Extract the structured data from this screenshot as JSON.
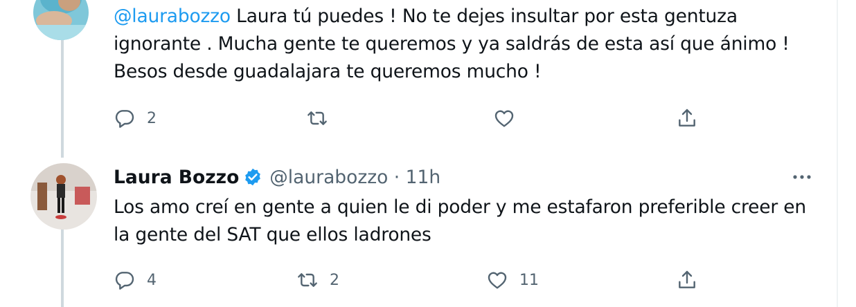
{
  "reply_tweet": {
    "mention": "@laurabozzo",
    "text_line1_rest": " Laura tú puedes ! No te dejes insultar por esta gentuza",
    "text_line2": "ignorante . Mucha gente te queremos y ya saldrás de esta así que ánimo !",
    "text_line3": "Besos desde guadalajara te queremos mucho !",
    "actions": {
      "reply_count": "2",
      "retweet_count": "",
      "like_count": ""
    }
  },
  "main_tweet": {
    "display_name": "Laura Bozzo",
    "handle_time": "@laurabozzo · 11h",
    "text_line1": "Los amo creí en gente a quien le di poder y me estafaron preferible creer en",
    "text_line2": "la gente del SAT que ellos ladrones",
    "actions": {
      "reply_count": "4",
      "retweet_count": "2",
      "like_count": "11"
    }
  },
  "colors": {
    "accent": "#1d9bf0",
    "secondary_text": "#536471",
    "thread_line": "#cfd9de"
  },
  "icons": [
    "reply-icon",
    "retweet-icon",
    "like-icon",
    "share-icon",
    "verified-badge-icon",
    "more-options-icon"
  ]
}
